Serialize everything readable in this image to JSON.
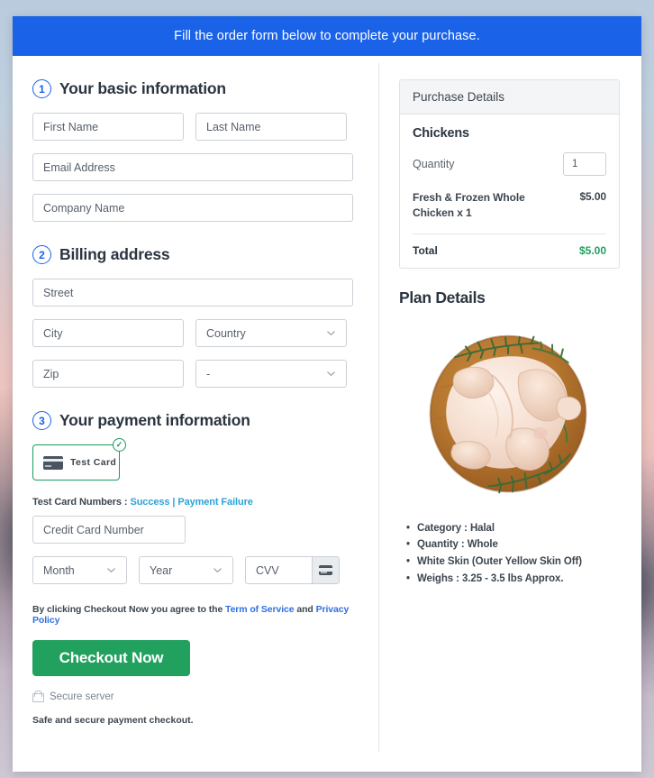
{
  "banner": {
    "message": "Fill the order form below to complete your purchase."
  },
  "steps": {
    "basic": {
      "number": "1",
      "title": "Your basic information",
      "first_name_placeholder": "First Name",
      "last_name_placeholder": "Last Name",
      "email_placeholder": "Email Address",
      "company_placeholder": "Company Name"
    },
    "billing": {
      "number": "2",
      "title": "Billing address",
      "street_placeholder": "Street",
      "city_placeholder": "City",
      "country_placeholder": "Country",
      "zip_placeholder": "Zip",
      "state_placeholder": "-"
    },
    "payment": {
      "number": "3",
      "title": "Your payment information",
      "method_label": "Test Card",
      "method_selected_mark": "✓",
      "test_cards_label": "Test Card Numbers :",
      "test_card_success": "Success",
      "test_card_separator": "|",
      "test_card_failure": "Payment Failure",
      "card_number_placeholder": "Credit Card Number",
      "month_placeholder": "Month",
      "year_placeholder": "Year",
      "cvv_placeholder": "CVV"
    }
  },
  "terms": {
    "prefix": "By clicking Checkout Now you agree to the",
    "tos_link": "Term of Service",
    "conjunction": "and",
    "privacy_link": "Privacy Policy"
  },
  "actions": {
    "checkout_label": "Checkout Now",
    "secure_server": "Secure server",
    "safe_note": "Safe and secure payment checkout."
  },
  "purchase": {
    "header": "Purchase Details",
    "product_name": "Chickens",
    "quantity_label": "Quantity",
    "quantity_value": "1",
    "line_item_desc": "Fresh & Frozen Whole Chicken x 1",
    "line_item_amount": "$5.00",
    "total_label": "Total",
    "total_amount": "$5.00"
  },
  "plan": {
    "title": "Plan Details",
    "details": [
      "Category : Halal",
      "Quantity : Whole",
      "White Skin (Outer Yellow Skin Off)",
      "Weighs : 3.25 - 3.5 lbs Approx."
    ]
  },
  "colors": {
    "banner_blue": "#1a62e8",
    "step_blue": "#1a62e8",
    "success_green": "#22a05e",
    "tile_green": "#1b9a5e",
    "link_blue": "#2f6fe0",
    "test_link": "#2ba3d9"
  }
}
